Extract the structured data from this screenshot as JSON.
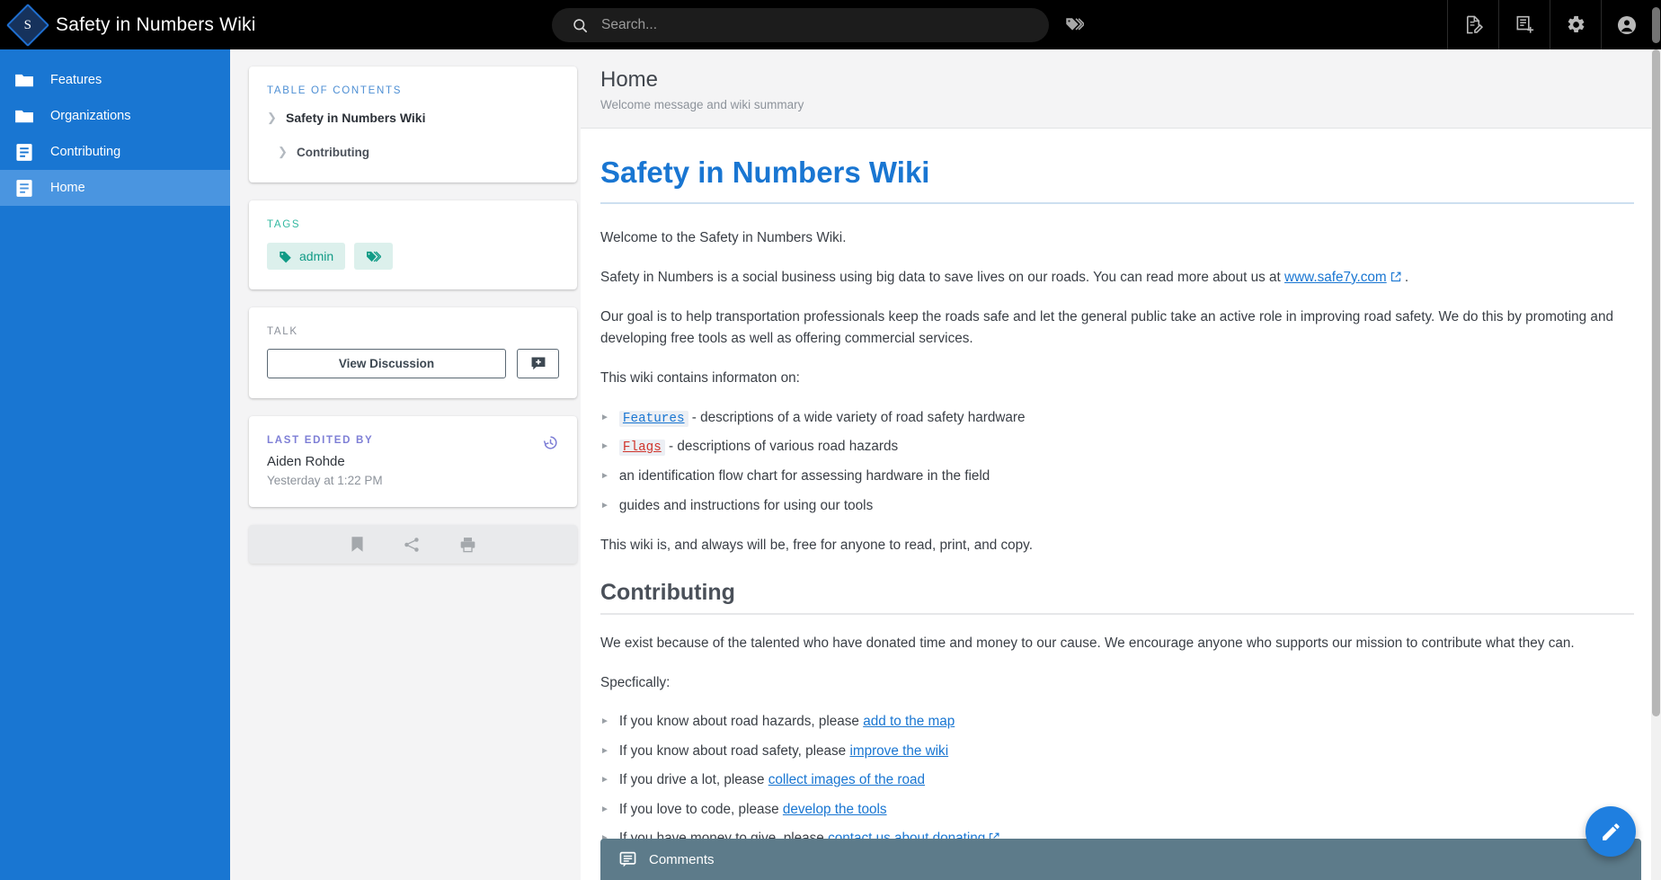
{
  "header": {
    "logo_letter": "S",
    "site_title": "Safety in Numbers Wiki",
    "search_placeholder": "Search...",
    "icons": {
      "tags": "tags-icon",
      "edit_page": "edit-page-icon",
      "new_page": "new-page-icon",
      "settings": "gear-icon",
      "account": "account-circle-icon"
    }
  },
  "sidebar": {
    "items": [
      {
        "label": "Features",
        "icon": "folder-icon",
        "active": false
      },
      {
        "label": "Organizations",
        "icon": "folder-icon",
        "active": false
      },
      {
        "label": "Contributing",
        "icon": "page-icon",
        "active": false
      },
      {
        "label": "Home",
        "icon": "page-icon",
        "active": true
      }
    ]
  },
  "toc": {
    "title": "TABLE OF CONTENTS",
    "items": [
      {
        "label": "Safety in Numbers Wiki",
        "level": 1
      },
      {
        "label": "Contributing",
        "level": 2
      }
    ]
  },
  "tags": {
    "title": "TAGS",
    "chips": [
      {
        "label": "admin",
        "icon": "tag-icon"
      },
      {
        "label": "",
        "icon": "tags-icon"
      }
    ]
  },
  "talk": {
    "title": "TALK",
    "view_discussion_label": "View Discussion",
    "new_comment_icon": "comment-plus-icon"
  },
  "last_edited": {
    "title": "LAST EDITED BY",
    "name": "Aiden Rohde",
    "time": "Yesterday at 1:22 PM",
    "history_icon": "history-icon"
  },
  "tools": {
    "bookmark": "bookmark-icon",
    "share": "share-icon",
    "print": "print-icon"
  },
  "page": {
    "title": "Home",
    "subtitle": "Welcome message and wiki summary"
  },
  "article": {
    "h1": "Safety in Numbers Wiki",
    "p1": "Welcome to the Safety in Numbers Wiki.",
    "p2_a": "Safety in Numbers is a social business using big data to save lives on our roads. You can read more about us at ",
    "p2_link": "www.safe7y.com",
    "p2_b": " .",
    "p3": "Our goal is to help transportation professionals keep the roads safe and let the general public take an active role in improving road safety. We do this by promoting and developing free tools as well as offering commercial services.",
    "p4": "This wiki contains informaton on:",
    "list1": [
      {
        "link": "Features",
        "link_style": "blue",
        "text": " - descriptions of a wide variety of road safety hardware"
      },
      {
        "link": "Flags",
        "link_style": "red",
        "text": " - descriptions of various road hazards"
      },
      {
        "link": "",
        "link_style": "none",
        "text": "an identification flow chart for assessing hardware in the field"
      },
      {
        "link": "",
        "link_style": "none",
        "text": "guides and instructions for using our tools"
      }
    ],
    "p5": "This wiki is, and always will be, free for anyone to read, print, and copy.",
    "h2": "Contributing",
    "p6": "We exist because of the talented who have donated time and money to our cause. We encourage anyone who supports our mission to contribute what they can.",
    "p7": "Specfically:",
    "list2": [
      {
        "pre": "If you know about road hazards, please ",
        "link": "add to the map",
        "external": false
      },
      {
        "pre": "If you know about road safety, please ",
        "link": "improve the wiki",
        "external": false
      },
      {
        "pre": "If you drive a lot, please ",
        "link": "collect images of the road",
        "external": false
      },
      {
        "pre": "If you love to code, please ",
        "link": "develop the tools",
        "external": false
      },
      {
        "pre": "If you have money to give, please ",
        "link": "contact us about donating",
        "external": true
      }
    ]
  },
  "comments": {
    "label": "Comments",
    "icon": "comment-icon"
  },
  "fab": {
    "icon": "pencil-icon"
  },
  "colors": {
    "sidebar_blue": "#1976d2",
    "sidebar_active": "#4a95e0",
    "title_blue": "#1976d2",
    "tag_teal": "#119b86",
    "comments_slate": "#5d7b8a",
    "red_link": "#d0342c"
  }
}
